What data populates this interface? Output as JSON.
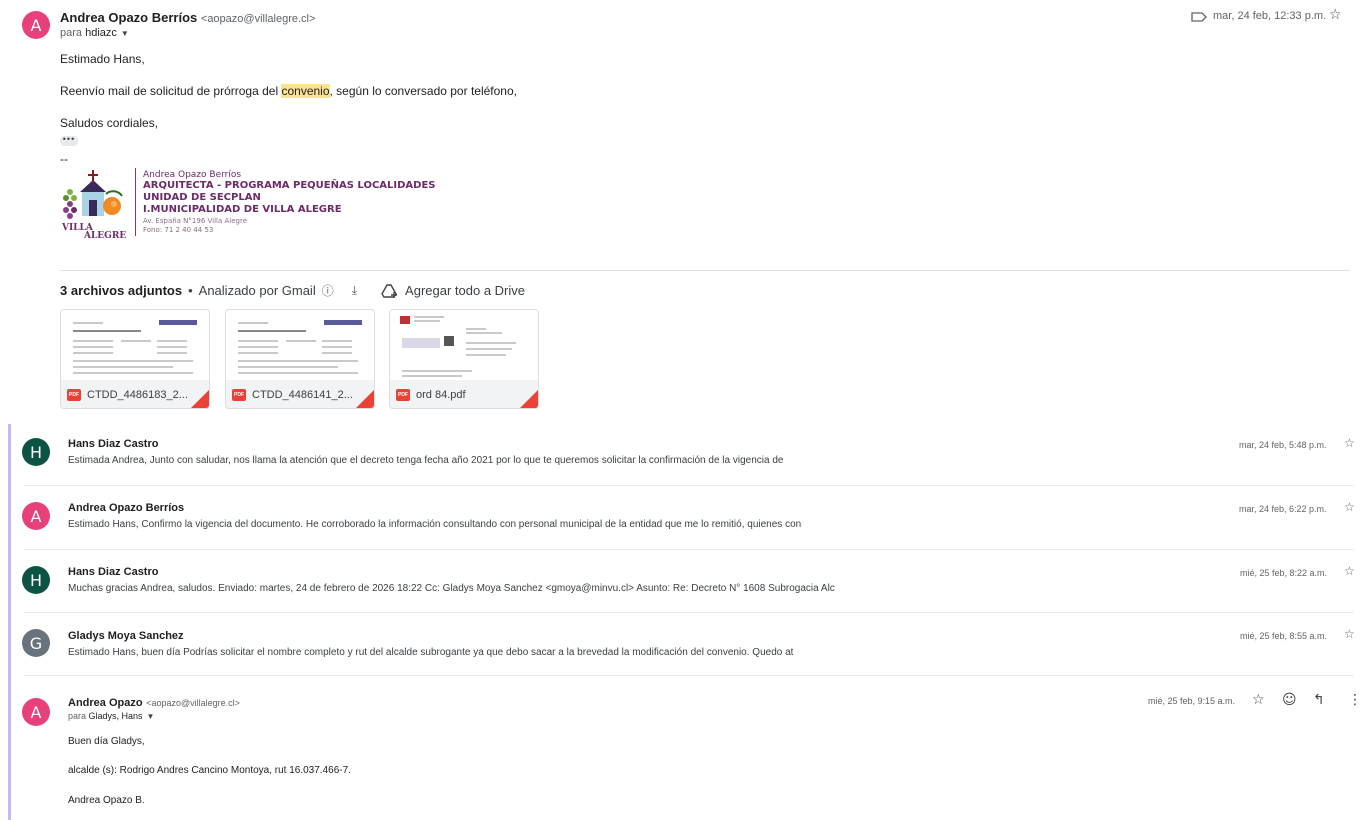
{
  "message1": {
    "avatar_letter": "A",
    "avatar_color": "#e8407a",
    "sender_name": "Andrea Opazo Berríos",
    "sender_email": "<aopazo@villalegre.cl>",
    "to_prefix": "para ",
    "to_recipient": "hdiazc",
    "date": "mar, 24 feb, 12:33 p.m.",
    "body": {
      "greeting": "Estimado Hans,",
      "line_pre": "Reenvío mail de solicitud de prórroga del ",
      "line_highlight": "convenio",
      "line_post": ", según lo conversado por teléfono,",
      "closing": "Saludos cordiales,",
      "dashes": "--"
    },
    "signature": {
      "name": "Andrea Opazo Berríos",
      "title": "ARQUITECTA - PROGRAMA PEQUEÑAS LOCALIDADES",
      "unit": "UNIDAD DE SECPLAN",
      "org": "I.MUNICIPALIDAD DE VILLA ALEGRE",
      "address": "Av. España N°196 Villa Alegre",
      "phone": "Fono: 71 2 40 44 53",
      "logo_text_1": "VILLA",
      "logo_text_2": "ALEGRE"
    },
    "attachments": {
      "count_label": "3 archivos adjuntos",
      "dot": "•",
      "scanned": "Analizado por Gmail",
      "drive": "Agregar todo a Drive",
      "files": [
        {
          "name": "CTDD_4486183_2...",
          "type": "PDF"
        },
        {
          "name": "CTDD_4486141_2...",
          "type": "PDF"
        },
        {
          "name": "ord 84.pdf",
          "type": "PDF"
        }
      ]
    }
  },
  "thread": [
    {
      "letter": "H",
      "color": "#0b5344",
      "name": "Hans Diaz Castro",
      "date": "mar, 24 feb, 5:48 p.m.",
      "snippet": "Estimada Andrea, Junto con saludar, nos llama la atención que el decreto tenga fecha año 2021 por lo que te queremos solicitar la confirmación de la vigencia de"
    },
    {
      "letter": "A",
      "color": "#e8407a",
      "name": "Andrea Opazo Berríos",
      "date": "mar, 24 feb, 6:22 p.m.",
      "snippet": "Estimado Hans, Confirmo la vigencia del documento. He corroborado la información consultando con personal municipal de la entidad que me lo remitió, quienes con"
    },
    {
      "letter": "H",
      "color": "#0b5344",
      "name": "Hans Diaz Castro",
      "date": "mié, 25 feb, 8:22 a.m.",
      "snippet": "Muchas gracias Andrea, saludos. Enviado: martes, 24 de febrero de 2026 18:22 Cc: Gladys Moya Sanchez <gmoya@minvu.cl> Asunto: Re: Decreto N° 1608 Subrogacia Alc"
    },
    {
      "letter": "G",
      "color": "#69737d",
      "name": "Gladys Moya Sanchez",
      "date": "mié, 25 feb, 8:55 a.m.",
      "snippet": "Estimado Hans, buen día Podrías solicitar el nombre completo y rut del alcalde subrogante ya que debo sacar a la brevedad la modificación del convenio. Quedo at"
    }
  ],
  "last_message": {
    "letter": "A",
    "color": "#e8407a",
    "name": "Andrea Opazo",
    "email": "<aopazo@villalegre.cl>",
    "to_prefix": "para ",
    "to_recipient": "Gladys, Hans",
    "date": "mié, 25 feb, 9:15 a.m.",
    "greeting": "Buen día Gladys,",
    "line": "alcalde (s): Rodrigo Andres Cancino Montoya, rut 16.037.466-7.",
    "signoff": "Andrea Opazo B."
  },
  "icons": {
    "label": "label-icon",
    "star": "star-icon",
    "info": "info-icon",
    "download": "download-icon",
    "drive_add": "drive-add-icon",
    "emoji": "emoji-icon",
    "reply": "reply-icon",
    "more": "more-vert-icon"
  },
  "colors": {
    "highlight": "#fde293",
    "thread_bar": "#c9b8f0",
    "signature_purple": "#6d2a6a"
  }
}
